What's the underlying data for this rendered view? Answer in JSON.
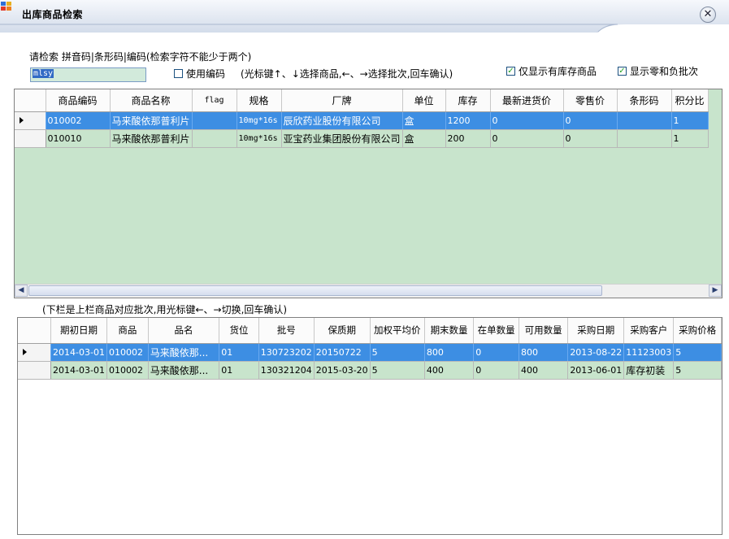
{
  "window": {
    "title": "出库商品检索",
    "close_label": "✕"
  },
  "search": {
    "instructions": "请检索 拼音码|条形码|编码(检索字符不能少于两个)",
    "value": "mlsy",
    "use_code_label": "使用编码",
    "use_code_checked": false,
    "hint": "(光标键↑、↓选择商品,←、→选择批次,回车确认)",
    "only_stock_label": "仅显示有库存商品",
    "only_stock_checked": true,
    "show_zero_neg_label": "显示零和负批次",
    "show_zero_neg_checked": true
  },
  "products": {
    "columns": [
      "商品编码",
      "商品名称",
      "flag",
      "规格",
      "厂牌",
      "单位",
      "库存",
      "最新进货价",
      "零售价",
      "条形码",
      "积分比"
    ],
    "rows": [
      [
        "010002",
        "马来酸依那普利片",
        "",
        "10mg*16s",
        "辰欣药业股份有限公司",
        "盒",
        "1200",
        "0",
        "0",
        "",
        "1"
      ],
      [
        "010010",
        "马来酸依那普利片",
        "",
        "10mg*16s",
        "亚宝药业集团股份有限公司",
        "盒",
        "200",
        "0",
        "0",
        "",
        "1"
      ]
    ]
  },
  "batches": {
    "caption": "(下栏是上栏商品对应批次,用光标键←、→切换,回车确认)",
    "columns": [
      "期初日期",
      "商品",
      "品名",
      "货位",
      "批号",
      "保质期",
      "加权平均价",
      "期末数量",
      "在单数量",
      "可用数量",
      "采购日期",
      "采购客户",
      "采购价格"
    ],
    "rows": [
      [
        "2014-03-01",
        "010002",
        "马来酸依那...",
        "01",
        "130723202",
        "20150722",
        "5",
        "800",
        "0",
        "800",
        "2013-08-22",
        "11123003",
        "5"
      ],
      [
        "2014-03-01",
        "010002",
        "马来酸依那...",
        "01",
        "130321204",
        "2015-03-20",
        "5",
        "400",
        "0",
        "400",
        "2013-06-01",
        "库存初装",
        "5"
      ]
    ]
  },
  "colors": {
    "selected_row": "#3d8ee3",
    "grid_bg": "#c8e4cc",
    "title_bg": "#d6e0f0"
  }
}
